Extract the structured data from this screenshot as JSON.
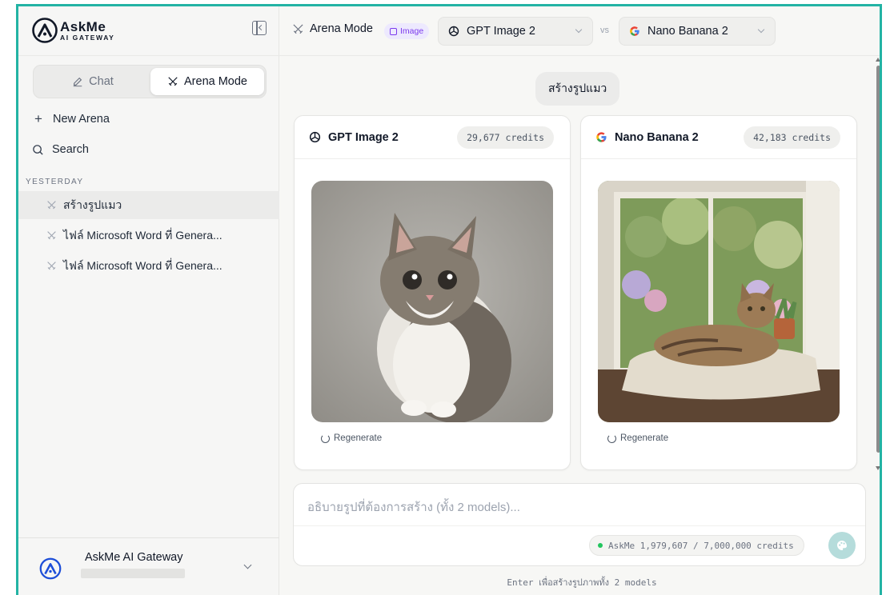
{
  "app": {
    "logo_big": "AskMe",
    "logo_small": "AI GATEWAY"
  },
  "sidebar": {
    "mode_chat": "Chat",
    "mode_arena": "Arena Mode",
    "new_arena": "New Arena",
    "search": "Search",
    "section_label": "YESTERDAY",
    "history": [
      {
        "label": "สร้างรูปแมว",
        "active": true
      },
      {
        "label": "ไฟล์ Microsoft Word ที่ Genera...",
        "active": false
      },
      {
        "label": "ไฟล์ Microsoft Word ที่ Genera...",
        "active": false
      }
    ],
    "user_name": "AskMe AI Gateway"
  },
  "topbar": {
    "title": "Arena Mode",
    "badge": "Image",
    "model_a": "GPT Image 2",
    "vs": "vs",
    "model_b": "Nano Banana 2"
  },
  "conversation": {
    "prompt": "สร้างรูปแมว",
    "cards": [
      {
        "model": "GPT Image 2",
        "credits": "29,677 credits",
        "regenerate": "Regenerate"
      },
      {
        "model": "Nano Banana 2",
        "credits": "42,183 credits",
        "regenerate": "Regenerate"
      }
    ]
  },
  "composer": {
    "placeholder": "อธิบายรูปที่ต้องการสร้าง (ทั้ง 2 models)...",
    "balance": "AskMe 1,979,607 / 7,000,000 credits",
    "hint": "Enter เพื่อสร้างรูปภาพทั้ง 2 models"
  },
  "colors": {
    "frame": "#23b3a4",
    "accent_purple": "#7c3aed",
    "status_green": "#22c55e",
    "send_button": "#b5dcdb"
  }
}
